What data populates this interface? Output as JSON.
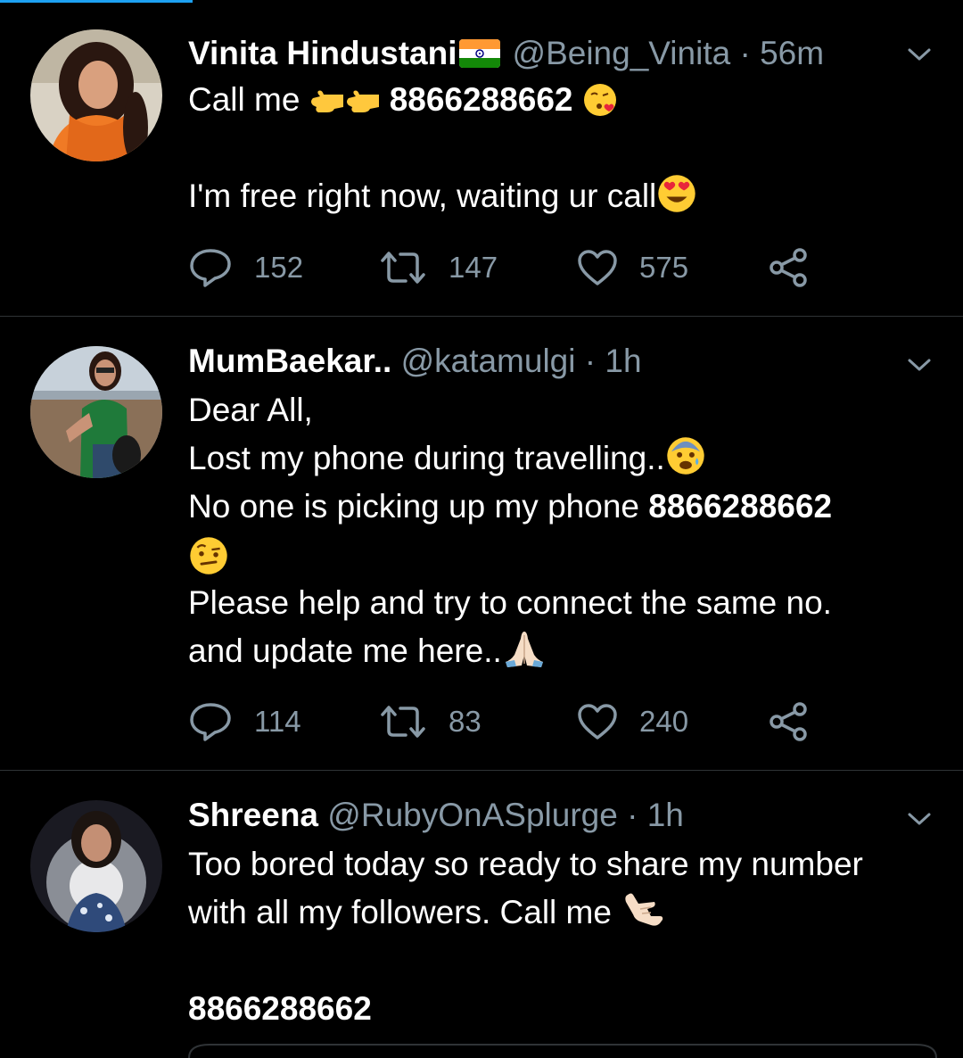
{
  "tweets": [
    {
      "display_name": "Vinita Hindustani",
      "handle": "@Being_Vinita",
      "separator": "·",
      "time": "56m",
      "flag_icon": "india-flag-icon",
      "text": {
        "line1_pre": "Call me",
        "line1_number": "8866288662",
        "line2": "I'm free right now, waiting ur call"
      },
      "emojis": [
        "pointing-left-hand-icon",
        "pointing-left-hand-icon",
        "face-blowing-kiss-icon",
        "heart-eyes-face-icon"
      ],
      "stats": {
        "replies": "152",
        "retweets": "147",
        "likes": "575"
      }
    },
    {
      "display_name": "MumBaekar..",
      "handle": "@katamulgi",
      "separator": "·",
      "time": "1h",
      "text": {
        "line1": "Dear All,",
        "line2": "Lost my phone during travelling..",
        "line3_pre": "No one is picking up my phone",
        "line3_number": "8866288662",
        "line5": "Please help and try to connect the same no.",
        "line6": "and update me here.."
      },
      "emojis": [
        "anxious-face-icon",
        "raised-eyebrow-face-icon",
        "folded-hands-icon"
      ],
      "stats": {
        "replies": "114",
        "retweets": "83",
        "likes": "240"
      }
    },
    {
      "display_name": "Shreena",
      "handle": "@RubyOnASplurge",
      "separator": "·",
      "time": "1h",
      "text": {
        "line1": "Too bored today so ready to share my number",
        "line2": "with all my followers. Call me",
        "line4_number": "8866288662"
      },
      "emojis": [
        "call-me-hand-icon"
      ]
    }
  ],
  "colors": {
    "background": "#000000",
    "text": "#ffffff",
    "secondary": "#8899a6",
    "divider": "#2f3336",
    "accent": "#1da1f2"
  }
}
